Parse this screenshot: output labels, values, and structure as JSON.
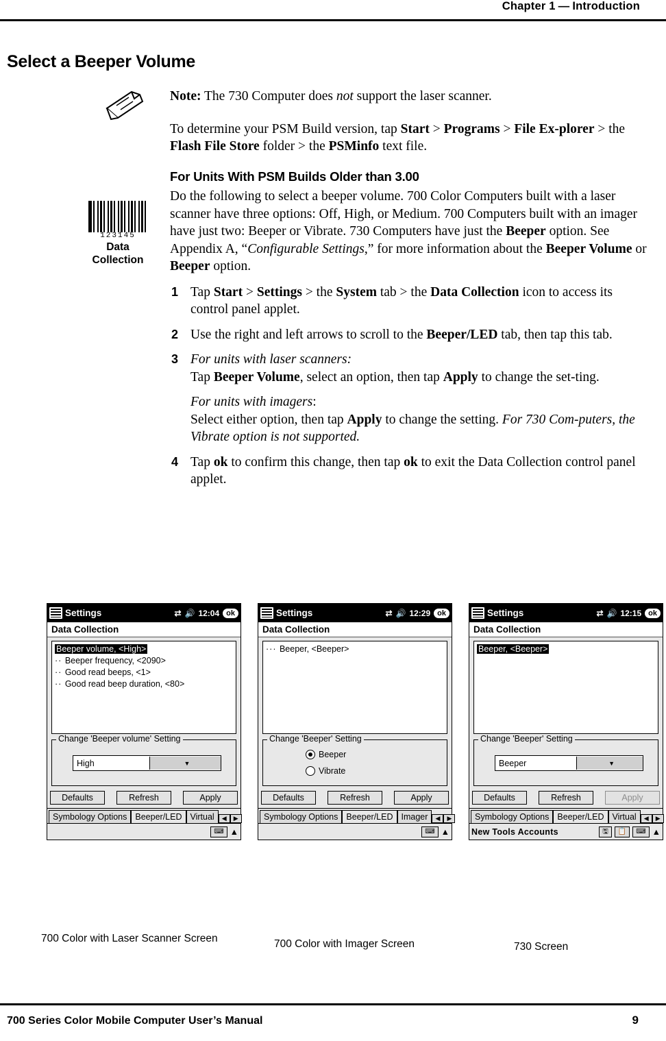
{
  "header": {
    "chapter": "Chapter  1",
    "dash": "—",
    "section": "Introduction"
  },
  "title": "Select a Beeper Volume",
  "note": {
    "label": "Note:",
    "text_1": " The 730 Computer does ",
    "italic": "not",
    "text_2": " support the laser scanner."
  },
  "para_build": {
    "t1": "To determine your PSM Build version, tap ",
    "b1": "Start",
    "t2": " > ",
    "b2": "Programs",
    "t3": " > ",
    "b3": "File Ex-",
    "b3b": "plorer",
    "t4": " > the ",
    "b4": "Flash File Store",
    "t5": " folder > the ",
    "b5": "PSMinfo",
    "t6": " text file."
  },
  "subhead": "For Units With PSM Builds Older than 3.00",
  "para_main": {
    "t1": "Do the following to select a beeper volume. 700 Color Computers built with a laser scanner have three options: Off, High, or Medium. 700 Computers built with an imager have just two: Beeper or Vibrate. 730 Computers have just the ",
    "b1": "Beeper",
    "t2": " option. See Appendix A, “",
    "i1": "Configurable Settings",
    "t3": ",” for more information about the ",
    "b2": "Beeper Volume",
    "t4": " or ",
    "b3": "Beeper",
    "t5": " option."
  },
  "steps": [
    {
      "num": "1",
      "parts": [
        {
          "t": "Tap "
        },
        {
          "b": "Start"
        },
        {
          "t": " > "
        },
        {
          "b": "Settings"
        },
        {
          "t": " > the "
        },
        {
          "b": "System"
        },
        {
          "t": " tab > the "
        },
        {
          "b": "Data Collection"
        },
        {
          "t": " icon to access its control panel applet."
        }
      ]
    },
    {
      "num": "2",
      "parts": [
        {
          "t": "Use the right and left arrows to scroll to the "
        },
        {
          "b": "Beeper/LED"
        },
        {
          "t": " tab, then tap this tab."
        }
      ]
    },
    {
      "num": "3",
      "parts": [
        {
          "i": "For units with laser scanners:"
        },
        {
          "br": true
        },
        {
          "t": "Tap "
        },
        {
          "b": "Beeper Volume"
        },
        {
          "t": ", select an option, then tap "
        },
        {
          "b": "Apply"
        },
        {
          "t": " to change the set-ting."
        },
        {
          "pgap": true
        },
        {
          "i": "For units with imagers"
        },
        {
          "t": ":"
        },
        {
          "br": true
        },
        {
          "t": "Select either option, then tap "
        },
        {
          "b": "Apply"
        },
        {
          "t": " to change the setting. "
        },
        {
          "i": "For 730 Com-puters, the Vibrate option is not supported."
        }
      ]
    },
    {
      "num": "4",
      "parts": [
        {
          "t": "Tap "
        },
        {
          "b": "ok"
        },
        {
          "t": " to confirm this change, then tap "
        },
        {
          "b": "ok"
        },
        {
          "t": " to exit the Data Collection control panel applet."
        }
      ]
    }
  ],
  "barcode_icon": {
    "digits": "123145",
    "line1": "Data",
    "line2": "Collection"
  },
  "screens": [
    {
      "titlebar": "Settings",
      "time": "12:04",
      "ok": "ok",
      "subbar": "Data Collection",
      "list": [
        {
          "text": "Beeper volume, <High>",
          "selected": true
        },
        {
          "text": "Beeper frequency, <2090>",
          "selected": false
        },
        {
          "text": "Good read beeps, <1>",
          "selected": false
        },
        {
          "text": "Good read beep duration, <80>",
          "selected": false
        }
      ],
      "group_legend": "Change 'Beeper volume' Setting",
      "combo_value": "High",
      "radios": [],
      "buttons": [
        {
          "label": "Defaults",
          "dim": false
        },
        {
          "label": "Refresh",
          "dim": false
        },
        {
          "label": "Apply",
          "dim": false
        }
      ],
      "tabs": [
        {
          "label": "Symbology Options",
          "active": false
        },
        {
          "label": "Beeper/LED",
          "active": true
        },
        {
          "label": "Virtual ",
          "active": false
        }
      ],
      "taskbar_left": "",
      "caption": "700 Color with Laser Scanner Screen"
    },
    {
      "titlebar": "Settings",
      "time": "12:29",
      "ok": "ok",
      "subbar": "Data Collection",
      "list": [
        {
          "text": "Beeper, <Beeper>",
          "selected": false,
          "dots": true
        }
      ],
      "group_legend": "Change 'Beeper' Setting",
      "combo_value": "",
      "radios": [
        {
          "label": "Beeper",
          "on": true
        },
        {
          "label": "Vibrate",
          "on": false
        }
      ],
      "buttons": [
        {
          "label": "Defaults",
          "dim": false
        },
        {
          "label": "Refresh",
          "dim": false
        },
        {
          "label": "Apply",
          "dim": false
        }
      ],
      "tabs": [
        {
          "label": "Symbology Options",
          "active": false
        },
        {
          "label": "Beeper/LED",
          "active": true
        },
        {
          "label": "Imager",
          "active": false
        }
      ],
      "taskbar_left": "",
      "caption": "700 Color with Imager Screen"
    },
    {
      "titlebar": "Settings",
      "time": "12:15",
      "ok": "ok",
      "subbar": "Data Collection",
      "list": [
        {
          "text": "Beeper, <Beeper>",
          "selected": true
        }
      ],
      "group_legend": "Change 'Beeper' Setting",
      "combo_value": "Beeper",
      "radios": [],
      "buttons": [
        {
          "label": "Defaults",
          "dim": false
        },
        {
          "label": "Refresh",
          "dim": false
        },
        {
          "label": "Apply",
          "dim": true
        }
      ],
      "tabs": [
        {
          "label": "Symbology Options",
          "active": false
        },
        {
          "label": "Beeper/LED",
          "active": true
        },
        {
          "label": "Virtual ",
          "active": false
        }
      ],
      "taskbar_left": "New  Tools  Accounts",
      "caption": "730 Screen"
    }
  ],
  "footer": {
    "left": "700 Series Color Mobile Computer User’s Manual",
    "right": "9"
  }
}
